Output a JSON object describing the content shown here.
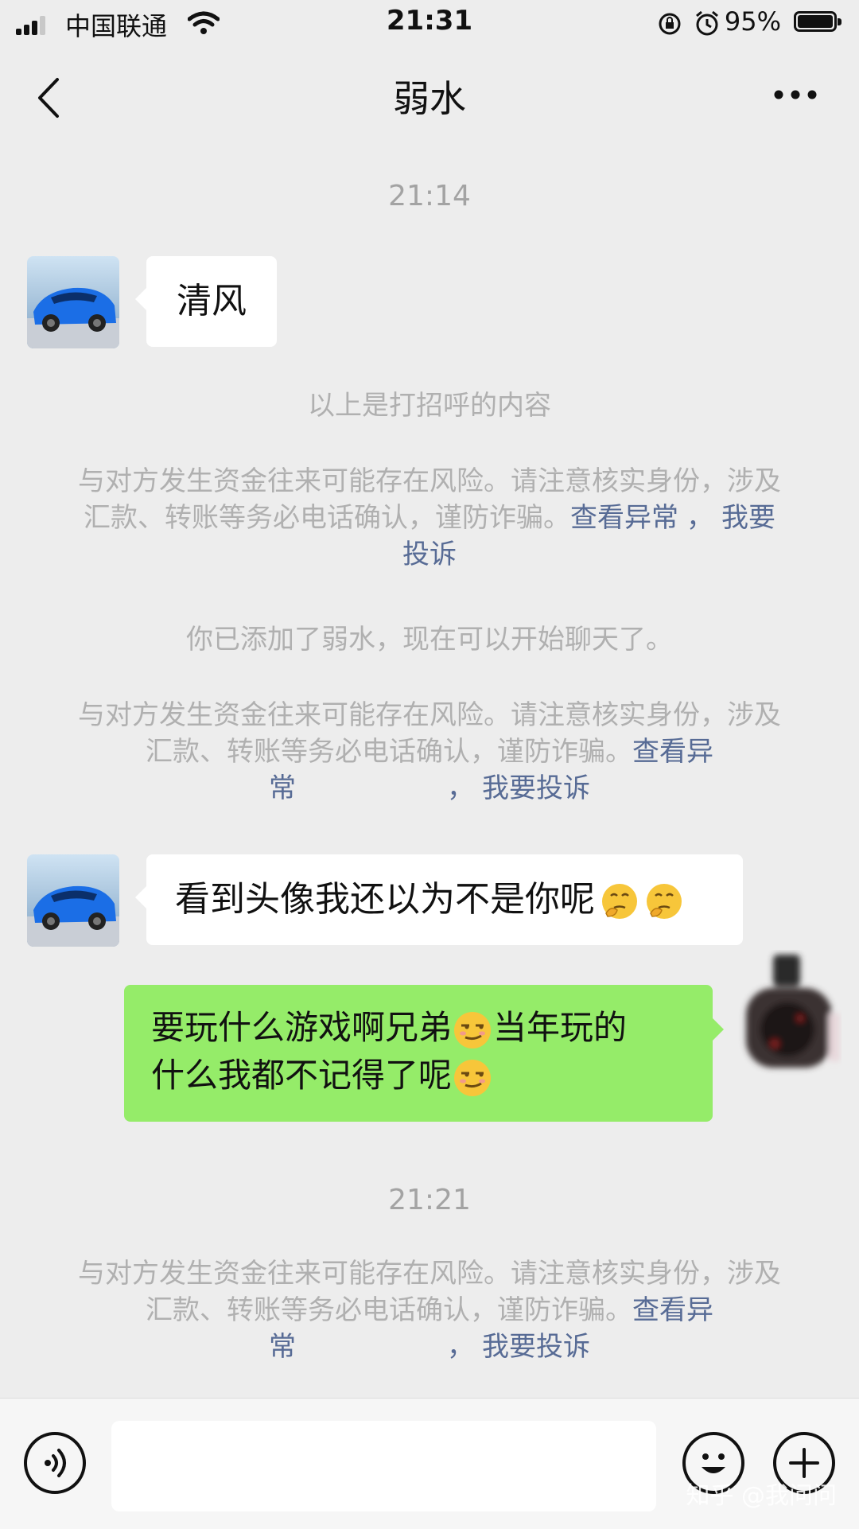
{
  "status_bar": {
    "carrier": "中国联通",
    "time": "21:31",
    "battery": "95%"
  },
  "nav": {
    "title": "弱水"
  },
  "messages": {
    "ts1": "21:14",
    "greeting": "清风",
    "hello_note": "以上是打招呼的内容",
    "warning_text": "与对方发生资金往来可能存在风险。请注意核实身份，涉及汇款、转账等务必电话确认，谨防诈骗。",
    "link_view": "查看异常",
    "link_sep": "，",
    "link_report": "我要投诉",
    "added_note": "你已添加了弱水，现在可以开始聊天了。",
    "received_text": "看到头像我还以为不是你呢",
    "sent_line1_a": "要玩什么游戏啊兄弟",
    "sent_line1_b": "当年玩的",
    "sent_line2": "什么我都不记得了呢",
    "ts2": "21:21"
  },
  "watermark": "知乎 @我问问",
  "icons": {
    "back": "chevron-left-icon",
    "more": "more-dots-icon",
    "voice": "voice-icon",
    "emoji": "emoji-icon",
    "plus": "plus-icon",
    "thinking_emoji": "thinking-face-emoji",
    "smirk_emoji": "smirk-face-emoji"
  },
  "colors": {
    "background": "#ededed",
    "sent_bubble": "#95ec69",
    "link": "#576b95",
    "system_text": "#b0b0b0"
  }
}
